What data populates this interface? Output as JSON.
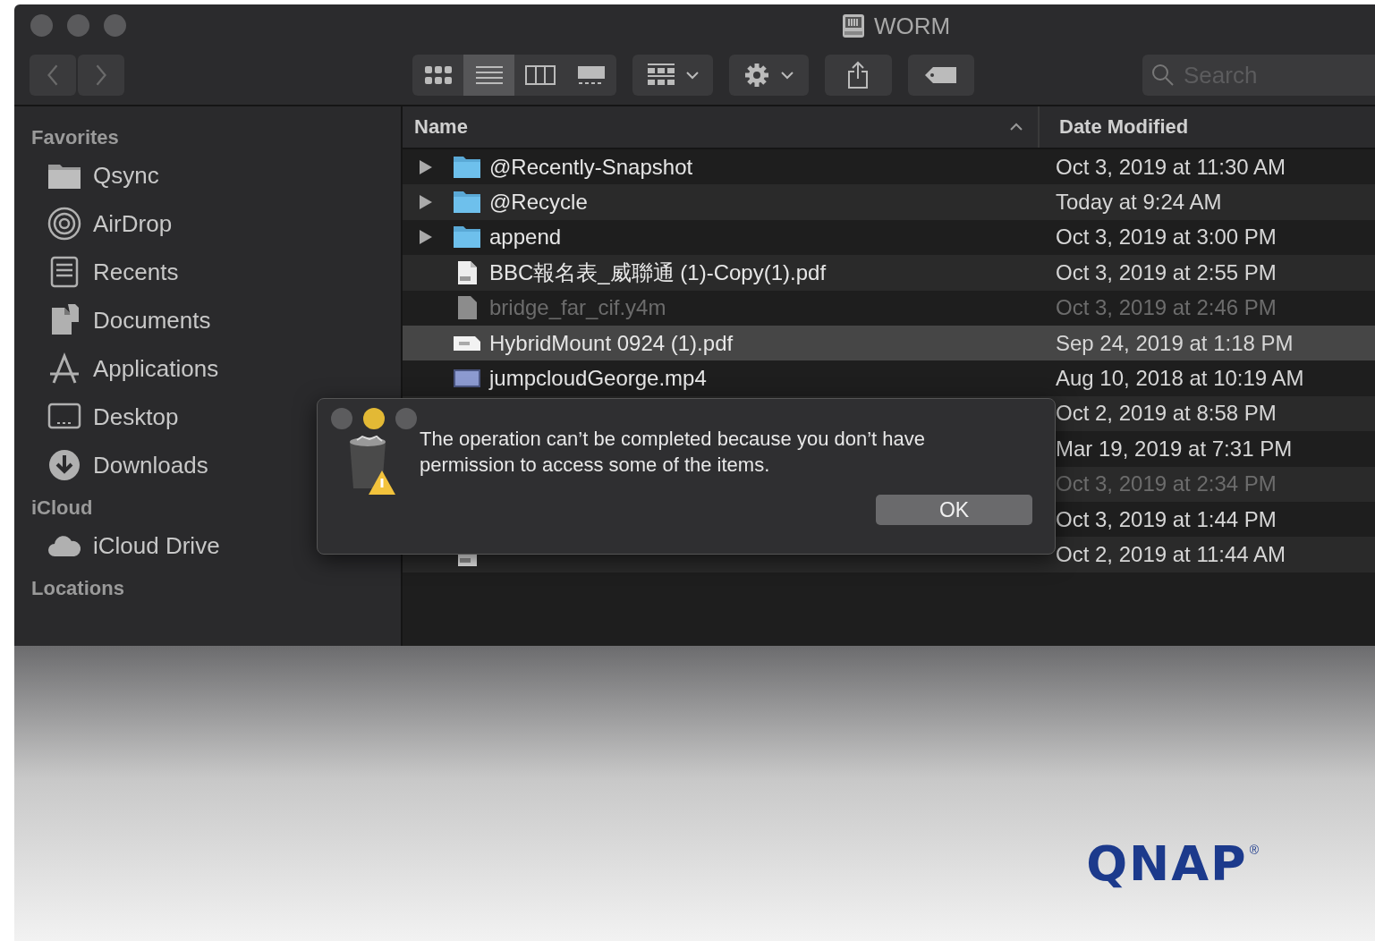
{
  "window": {
    "title": "WORM"
  },
  "toolbar": {
    "view_modes": [
      {
        "kind": "icons",
        "selected": false
      },
      {
        "kind": "list",
        "selected": true
      },
      {
        "kind": "columns",
        "selected": false
      },
      {
        "kind": "gallery",
        "selected": false
      }
    ],
    "search": {
      "placeholder": "Search"
    }
  },
  "sidebar": {
    "sections": [
      {
        "title": "Favorites",
        "items": [
          {
            "label": "Qsync",
            "kind": "folder"
          },
          {
            "label": "AirDrop",
            "kind": "airdrop"
          },
          {
            "label": "Recents",
            "kind": "recents"
          },
          {
            "label": "Documents",
            "kind": "documents"
          },
          {
            "label": "Applications",
            "kind": "applications"
          },
          {
            "label": "Desktop",
            "kind": "desktop"
          },
          {
            "label": "Downloads",
            "kind": "downloads"
          }
        ]
      },
      {
        "title": "iCloud",
        "items": [
          {
            "label": "iCloud Drive",
            "kind": "cloud"
          }
        ]
      },
      {
        "title": "Locations"
      }
    ]
  },
  "table": {
    "columns": [
      {
        "label": "Name",
        "sorted": true
      },
      {
        "label": "Date Modified",
        "sorted": false
      }
    ],
    "rows": [
      {
        "name": "@Recently-Snapshot",
        "date": "Oct 3, 2019 at 11:30 AM",
        "kind": "folder",
        "selected": false,
        "disabled": false
      },
      {
        "name": "@Recycle",
        "date": "Today at 9:24 AM",
        "kind": "folder",
        "selected": false,
        "disabled": false
      },
      {
        "name": "append",
        "date": "Oct 3, 2019 at 3:00 PM",
        "kind": "folder",
        "selected": false,
        "disabled": false
      },
      {
        "name": "BBC報名表_威聯通 (1)-Copy(1).pdf",
        "date": "Oct 3, 2019 at 2:55 PM",
        "kind": "pdf",
        "selected": false,
        "disabled": false
      },
      {
        "name": "bridge_far_cif.y4m",
        "date": "Oct 3, 2019 at 2:46 PM",
        "kind": "file",
        "selected": false,
        "disabled": true
      },
      {
        "name": "HybridMount 0924 (1).pdf",
        "date": "Sep 24, 2019 at 1:18 PM",
        "kind": "document",
        "selected": true,
        "disabled": false
      },
      {
        "name": "jumpcloudGeorge.mp4",
        "date": "Aug 10, 2018 at 10:19 AM",
        "kind": "video",
        "selected": false,
        "disabled": false
      },
      {
        "date": "Oct 2, 2019 at 8:58 PM",
        "selected": false,
        "disabled": false
      },
      {
        "date": "Mar 19, 2019 at 7:31 PM",
        "selected": false,
        "disabled": false
      },
      {
        "date": "Oct 3, 2019 at 2:34 PM",
        "selected": false,
        "disabled": true
      },
      {
        "date": "Oct 3, 2019 at 1:44 PM",
        "selected": false,
        "disabled": false
      },
      {
        "date": "Oct 2, 2019 at 11:44 AM",
        "kind": "pdf",
        "selected": false,
        "disabled": false
      }
    ]
  },
  "dialog": {
    "message": "The operation can’t be completed because you don’t have permission to access some of the items.",
    "buttons": [
      "OK"
    ]
  },
  "logo": {
    "text": "QNAP",
    "mark": "®"
  }
}
